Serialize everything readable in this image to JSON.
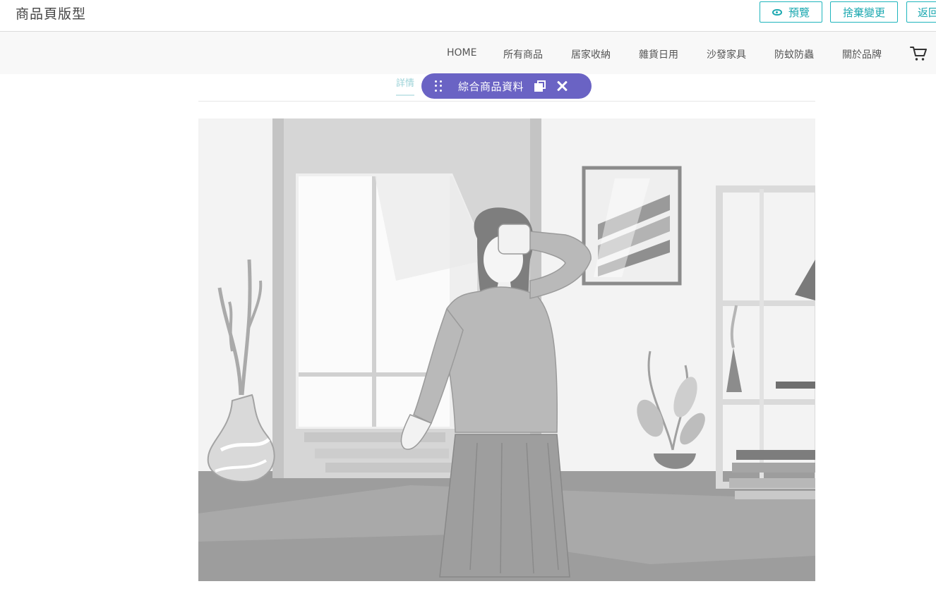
{
  "editor": {
    "title": "商品頁版型",
    "preview_label": "預覽",
    "discard_label": "捨棄變更",
    "back_label": "返回"
  },
  "nav": {
    "items": [
      "HOME",
      "所有商品",
      "居家收納",
      "雜貨日用",
      "沙發家具",
      "防蚊防蟲",
      "關於品牌"
    ]
  },
  "section": {
    "tab_label": "詳情",
    "toolbar_label": "綜合商品資料"
  },
  "colors": {
    "accent": "#1fb5bd",
    "toolbar": "#6a63c4"
  },
  "icons": [
    "eye-icon",
    "shopping-cart-icon",
    "drag-handle-icon",
    "duplicate-icon",
    "close-icon"
  ]
}
